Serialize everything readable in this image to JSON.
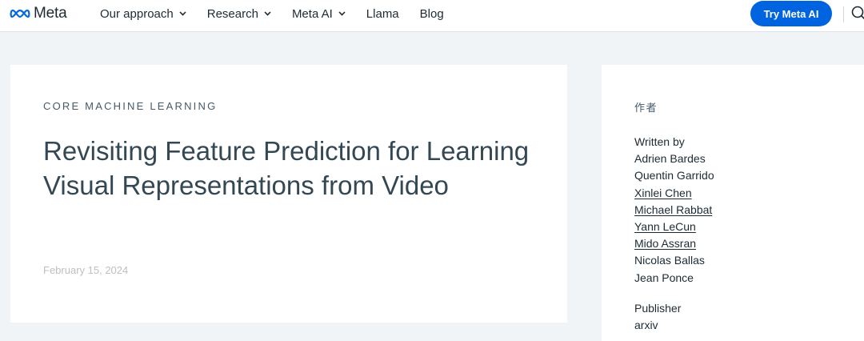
{
  "nav": {
    "logo_text": "Meta",
    "items": [
      {
        "label": "Our approach",
        "dropdown": true
      },
      {
        "label": "Research",
        "dropdown": true
      },
      {
        "label": "Meta AI",
        "dropdown": true
      },
      {
        "label": "Llama",
        "dropdown": false
      },
      {
        "label": "Blog",
        "dropdown": false
      }
    ],
    "cta_label": "Try Meta AI",
    "search_icon": "search-icon"
  },
  "article": {
    "category": "CORE MACHINE LEARNING",
    "title": "Revisiting Feature Prediction for Learning Visual Representations from Video",
    "date": "February 15, 2024"
  },
  "sidebar": {
    "heading": "作者",
    "written_by_label": "Written by",
    "authors": [
      {
        "name": "Adrien Bardes",
        "link": false
      },
      {
        "name": "Quentin Garrido",
        "link": false
      },
      {
        "name": "Xinlei Chen",
        "link": true
      },
      {
        "name": "Michael Rabbat",
        "link": true
      },
      {
        "name": "Yann LeCun",
        "link": true
      },
      {
        "name": "Mido Assran",
        "link": true
      },
      {
        "name": "Nicolas Ballas",
        "link": false
      },
      {
        "name": "Jean Ponce",
        "link": false
      }
    ],
    "publisher_label": "Publisher",
    "publisher": "arxiv"
  },
  "colors": {
    "accent": "#0064e0",
    "page_bg": "#f1f4f7",
    "text": "#1c2b33"
  }
}
